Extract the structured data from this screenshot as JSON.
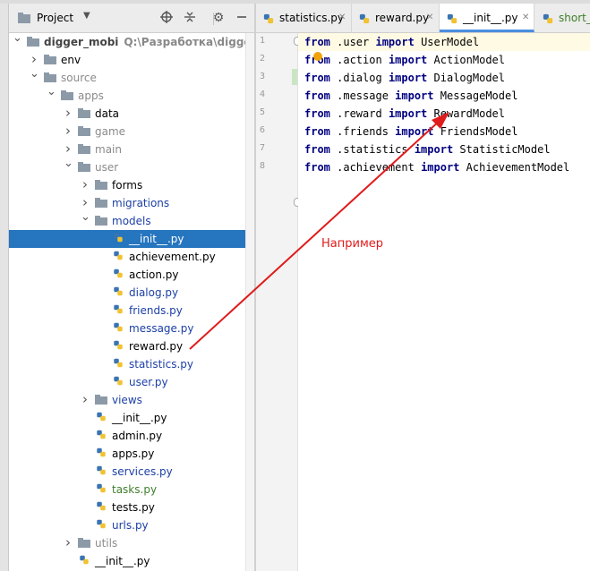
{
  "project_panel": {
    "title": "Project",
    "tree": [
      {
        "label": "digger_mobi",
        "path": "Q:\\Разработка\\digger_mob",
        "depth": 0,
        "type": "folder",
        "expanded": true,
        "style": "bold"
      },
      {
        "label": "env",
        "depth": 1,
        "type": "folder",
        "expanded": false,
        "style": "normal"
      },
      {
        "label": "source",
        "depth": 1,
        "type": "folder",
        "expanded": true,
        "style": "dim"
      },
      {
        "label": "apps",
        "depth": 2,
        "type": "folder",
        "expanded": true,
        "style": "dim"
      },
      {
        "label": "data",
        "depth": 3,
        "type": "folder",
        "expanded": false,
        "style": "normal"
      },
      {
        "label": "game",
        "depth": 3,
        "type": "folder",
        "expanded": false,
        "style": "dim"
      },
      {
        "label": "main",
        "depth": 3,
        "type": "folder",
        "expanded": false,
        "style": "dim"
      },
      {
        "label": "user",
        "depth": 3,
        "type": "folder",
        "expanded": true,
        "style": "dim"
      },
      {
        "label": "forms",
        "depth": 4,
        "type": "folder",
        "expanded": false,
        "style": "normal"
      },
      {
        "label": "migrations",
        "depth": 4,
        "type": "folder",
        "expanded": false,
        "style": "blue"
      },
      {
        "label": "models",
        "depth": 4,
        "type": "folder",
        "expanded": true,
        "style": "blue"
      },
      {
        "label": "__init__.py",
        "depth": 5,
        "type": "py",
        "style": "selected"
      },
      {
        "label": "achievement.py",
        "depth": 5,
        "type": "py",
        "style": "normal"
      },
      {
        "label": "action.py",
        "depth": 5,
        "type": "py",
        "style": "normal"
      },
      {
        "label": "dialog.py",
        "depth": 5,
        "type": "py",
        "style": "blue"
      },
      {
        "label": "friends.py",
        "depth": 5,
        "type": "py",
        "style": "blue"
      },
      {
        "label": "message.py",
        "depth": 5,
        "type": "py",
        "style": "blue"
      },
      {
        "label": "reward.py",
        "depth": 5,
        "type": "py",
        "style": "normal"
      },
      {
        "label": "statistics.py",
        "depth": 5,
        "type": "py",
        "style": "blue"
      },
      {
        "label": "user.py",
        "depth": 5,
        "type": "py",
        "style": "blue"
      },
      {
        "label": "views",
        "depth": 4,
        "type": "folder",
        "expanded": false,
        "style": "blue"
      },
      {
        "label": "__init__.py",
        "depth": 4,
        "type": "py",
        "style": "normal"
      },
      {
        "label": "admin.py",
        "depth": 4,
        "type": "py",
        "style": "normal"
      },
      {
        "label": "apps.py",
        "depth": 4,
        "type": "py",
        "style": "normal"
      },
      {
        "label": "services.py",
        "depth": 4,
        "type": "py",
        "style": "blue"
      },
      {
        "label": "tasks.py",
        "depth": 4,
        "type": "py",
        "style": "green"
      },
      {
        "label": "tests.py",
        "depth": 4,
        "type": "py",
        "style": "normal"
      },
      {
        "label": "urls.py",
        "depth": 4,
        "type": "py",
        "style": "blue"
      },
      {
        "label": "utils",
        "depth": 3,
        "type": "folder",
        "expanded": false,
        "style": "dim"
      },
      {
        "label": "__init__.py",
        "depth": 3,
        "type": "py",
        "style": "normal"
      }
    ]
  },
  "editor": {
    "tabs": [
      {
        "label": "statistics.py",
        "active": false
      },
      {
        "label": "reward.py",
        "active": false
      },
      {
        "label": "__init__.py",
        "active": true
      },
      {
        "label": "short_f",
        "active": false
      }
    ],
    "lines": [
      {
        "num": "1",
        "parts": [
          [
            "kw",
            "from"
          ],
          [
            "t",
            " .user "
          ],
          [
            "kw",
            "import"
          ],
          [
            "t",
            " UserModel"
          ]
        ]
      },
      {
        "num": "2",
        "parts": [
          [
            "kw",
            "from"
          ],
          [
            "t",
            " .action "
          ],
          [
            "kw",
            "import"
          ],
          [
            "t",
            " ActionModel"
          ]
        ]
      },
      {
        "num": "3",
        "parts": [
          [
            "kw",
            "from"
          ],
          [
            "t",
            " .dialog "
          ],
          [
            "kw",
            "import"
          ],
          [
            "t",
            " DialogModel"
          ]
        ]
      },
      {
        "num": "4",
        "parts": [
          [
            "kw",
            "from"
          ],
          [
            "t",
            " .message "
          ],
          [
            "kw",
            "import"
          ],
          [
            "t",
            " MessageModel"
          ]
        ]
      },
      {
        "num": "5",
        "parts": [
          [
            "kw",
            "from"
          ],
          [
            "t",
            " .reward "
          ],
          [
            "kw",
            "import"
          ],
          [
            "t",
            " RewardModel"
          ]
        ]
      },
      {
        "num": "6",
        "parts": [
          [
            "kw",
            "from"
          ],
          [
            "t",
            " .friends "
          ],
          [
            "kw",
            "import"
          ],
          [
            "t",
            " FriendsModel"
          ]
        ]
      },
      {
        "num": "7",
        "parts": [
          [
            "kw",
            "from"
          ],
          [
            "t",
            " .statistics "
          ],
          [
            "kw",
            "import"
          ],
          [
            "t",
            " StatisticModel"
          ]
        ]
      },
      {
        "num": "8",
        "parts": [
          [
            "kw",
            "from"
          ],
          [
            "t",
            " .achievement "
          ],
          [
            "kw",
            "import"
          ],
          [
            "t",
            " AchievementModel"
          ]
        ]
      }
    ]
  },
  "annotation": {
    "text": "Например",
    "color": "#e01b1b"
  },
  "colors": {
    "selection": "#2675bf",
    "keyword": "#000080",
    "folder": "#8c9aa8",
    "blue_text": "#1c3fa6",
    "green_text": "#3f7f2b"
  },
  "icons": {
    "project": "project-folder-icon",
    "target": "crosshair-icon",
    "collapse": "collapse-all-icon",
    "settings": "gear-icon",
    "hide": "hide-panel-icon"
  }
}
